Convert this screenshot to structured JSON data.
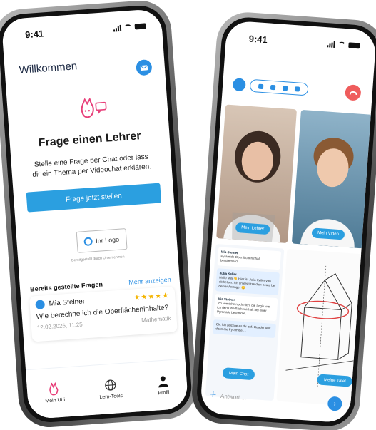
{
  "phone_left": {
    "status": {
      "time": "9:41"
    },
    "header": {
      "welcome": "Willkommen"
    },
    "hero": {
      "title": "Frage einen Lehrer",
      "text_line1": "Stelle eine Frage per Chat oder lass",
      "text_line2": "dir ein Thema per Videochat erklären.",
      "cta_label": "Frage jetzt stellen"
    },
    "logo_box": {
      "label": "Ihr Logo",
      "caption": "Bereitgestellt durch Unternehmen"
    },
    "questions": {
      "heading": "Bereits gestellte Fragen",
      "more_label": "Mehr anzeigen",
      "items": [
        {
          "user": "Mia Steiner",
          "stars": "★★★★★",
          "text": "Wie berechne ich die Oberflächeninhalte?",
          "date": "12.02.2026, 11:25",
          "subject": "Mathematik"
        }
      ]
    },
    "nav": [
      {
        "label": "Mein Ubi",
        "icon": "rabbit-logo-icon"
      },
      {
        "label": "Lern-Tools",
        "icon": "globe-icon"
      },
      {
        "label": "Profil",
        "icon": "person-icon"
      }
    ],
    "colors": {
      "accent": "#2b9fe0",
      "logo": "#e8407a"
    }
  },
  "phone_right": {
    "status": {
      "time": "9:41"
    },
    "video": {
      "teacher_label": "Mein Lehrer",
      "student_label": "Mein Video"
    },
    "chat": {
      "messages": [
        {
          "name": "Mia Steiner",
          "text": "Pyramide Oberflächeninhalt bestimmen?",
          "style": "plain"
        },
        {
          "name": "Julia Keller",
          "text": "Hallo Mia 👋 Hier ist Julia Keller von ubihelper. Ich unterstütze dich heute bei deiner Anfrage. 😊",
          "style": "blue"
        },
        {
          "name": "Mia Steiner",
          "text": "Ich verstehe noch nicht die Logik wie ich den Oberflächeninhalt bei einer Pyramide bestimme.",
          "style": "plain"
        },
        {
          "name": "",
          "text": "Ok, ich zeichne es dir auf. Quader und dann die Pyramide …",
          "style": "blue"
        }
      ]
    },
    "buttons": {
      "chat_label": "Mein Chat",
      "board_label": "Meine Tafel"
    },
    "input": {
      "placeholder": "Antwort ..."
    },
    "colors": {
      "hangup": "#ef5c5c"
    }
  }
}
